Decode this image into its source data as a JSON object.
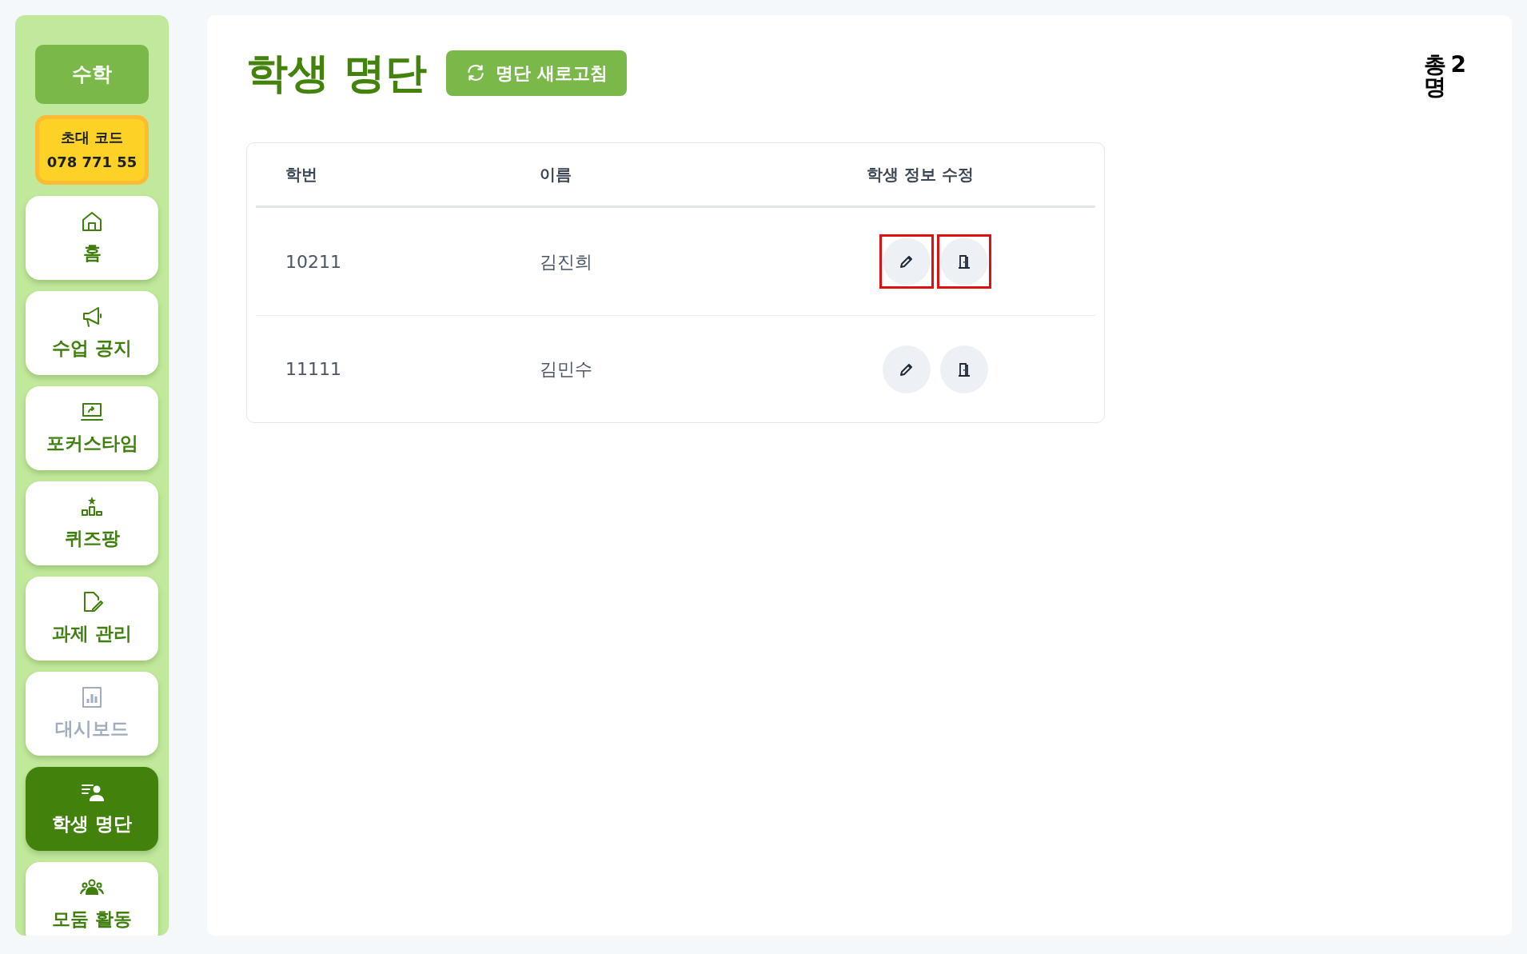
{
  "sidebar": {
    "subject": "수학",
    "invite": {
      "label": "초대 코드",
      "code": "078 771 55"
    },
    "items": [
      {
        "label": "홈",
        "selected": false,
        "disabled": false
      },
      {
        "label": "수업 공지",
        "selected": false,
        "disabled": false
      },
      {
        "label": "포커스타임",
        "selected": false,
        "disabled": false
      },
      {
        "label": "퀴즈팡",
        "selected": false,
        "disabled": false
      },
      {
        "label": "과제 관리",
        "selected": false,
        "disabled": false
      },
      {
        "label": "대시보드",
        "selected": false,
        "disabled": true
      },
      {
        "label": "학생 명단",
        "selected": true,
        "disabled": false
      },
      {
        "label": "모둠 활동",
        "selected": false,
        "disabled": false
      }
    ]
  },
  "header": {
    "title": "학생 명단",
    "refresh_button": "명단 새로고침",
    "total": {
      "prefix": "총",
      "count": "2",
      "suffix": "명"
    }
  },
  "table": {
    "columns": [
      "학번",
      "이름",
      "학생 정보 수정"
    ],
    "rows": [
      {
        "id": "10211",
        "name": "김진희",
        "edit_highlighted": true,
        "exit_highlighted": true
      },
      {
        "id": "11111",
        "name": "김민수",
        "edit_highlighted": false,
        "exit_highlighted": false
      }
    ]
  }
}
